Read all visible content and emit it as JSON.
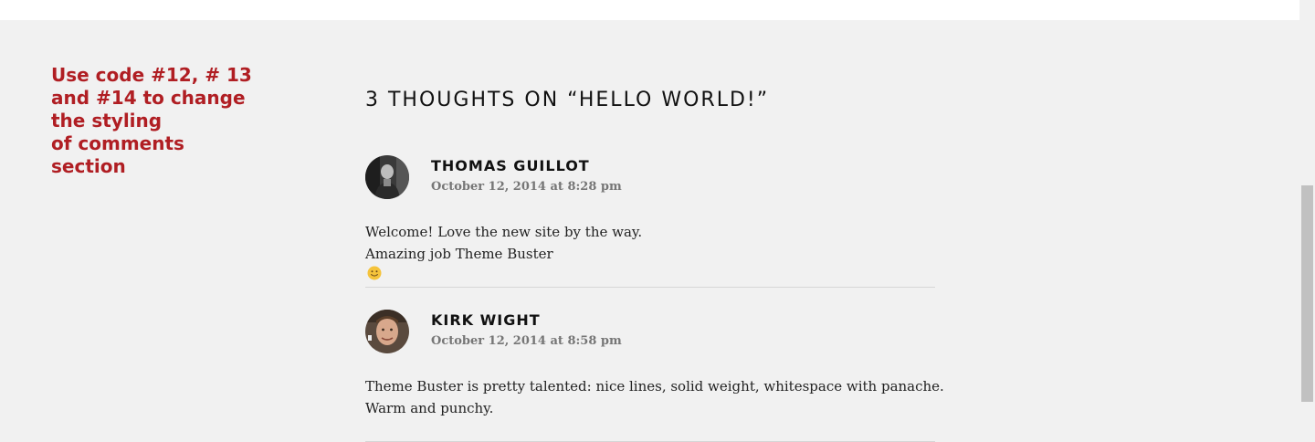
{
  "annotation": {
    "lines": [
      "Use code #12, # 13",
      "and #14 to change",
      "the styling",
      "of comments",
      "section"
    ],
    "color": "#b01e23"
  },
  "comments_section": {
    "title": "3 THOUGHTS ON “HELLO WORLD!”",
    "comments": [
      {
        "author": "THOMAS GUILLOT",
        "date": "October 12, 2014 at 8:28 pm",
        "lines": [
          "Welcome! Love the new site by the way.",
          "Amazing job Theme Buster"
        ],
        "emoji": "slightly-smiling-face-icon"
      },
      {
        "author": "KIRK WIGHT",
        "date": "October 12, 2014 at 8:58 pm",
        "lines": [
          "Theme Buster is pretty talented: nice lines, solid weight, whitespace with panache.",
          "Warm and punchy."
        ]
      }
    ]
  }
}
